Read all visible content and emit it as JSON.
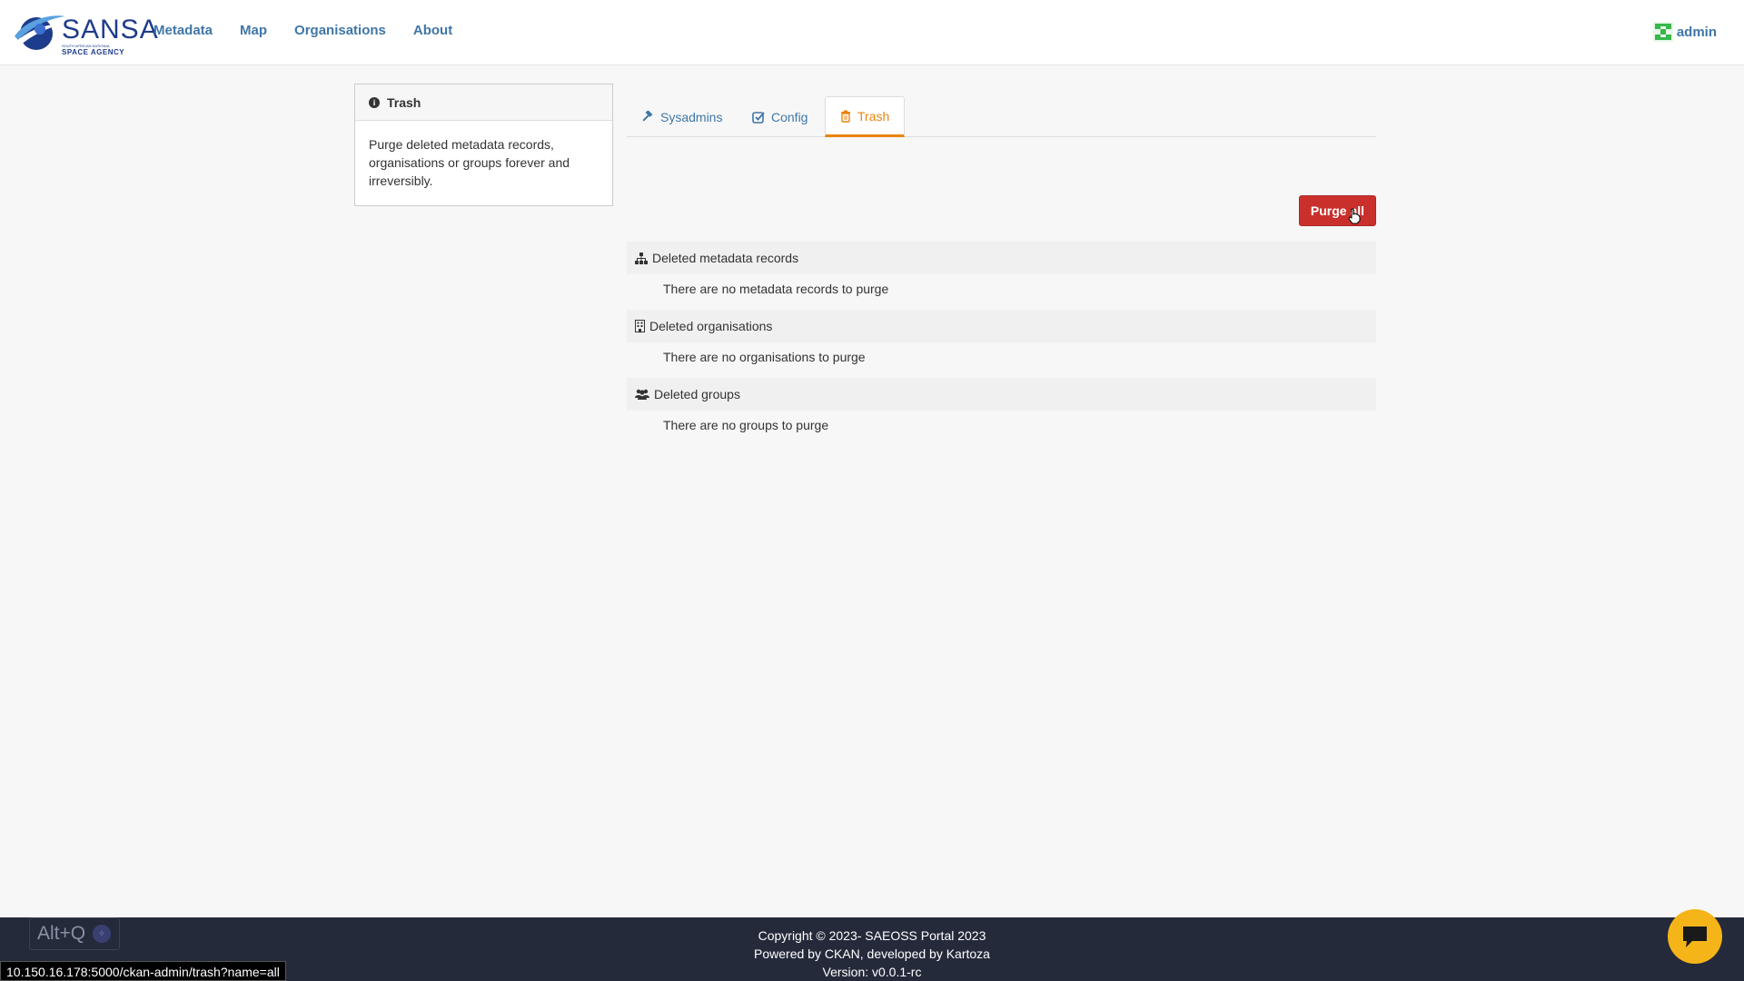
{
  "header": {
    "logo": {
      "brand": "SANSA",
      "line1": "SOUTH AFRICAN NATIONAL",
      "line2": "SPACE AGENCY"
    },
    "nav": [
      "Metadata",
      "Map",
      "Organisations",
      "About"
    ],
    "user": "admin"
  },
  "sidebar": {
    "title": "Trash",
    "description": "Purge deleted metadata records, organisations or groups forever and irreversibly."
  },
  "tabs": [
    {
      "label": "Sysadmins",
      "icon": "gavel-icon"
    },
    {
      "label": "Config",
      "icon": "check-square-icon"
    },
    {
      "label": "Trash",
      "icon": "trash-icon",
      "active": true
    }
  ],
  "purge_all_label": "Purge all",
  "sections": [
    {
      "title": "Deleted metadata records",
      "icon": "sitemap-icon",
      "empty": "There are no metadata records to purge"
    },
    {
      "title": "Deleted organisations",
      "icon": "building-icon",
      "empty": "There are no organisations to purge"
    },
    {
      "title": "Deleted groups",
      "icon": "users-icon",
      "empty": "There are no groups to purge"
    }
  ],
  "footer": {
    "copyright": "Copyright © 2023- SAEOSS Portal 2023",
    "powered": "Powered by CKAN, developed by Kartoza",
    "version": "Version: v0.0.1-rc"
  },
  "overlay": {
    "shortcut": "Alt+Q",
    "status_url": "10.150.16.178:5000/ckan-admin/trash?name=all"
  },
  "colors": {
    "accent": "#e8840e",
    "link": "#3f76a8",
    "danger": "#c9302c",
    "footer_bg": "#252a3b",
    "chat": "#f5b519"
  }
}
